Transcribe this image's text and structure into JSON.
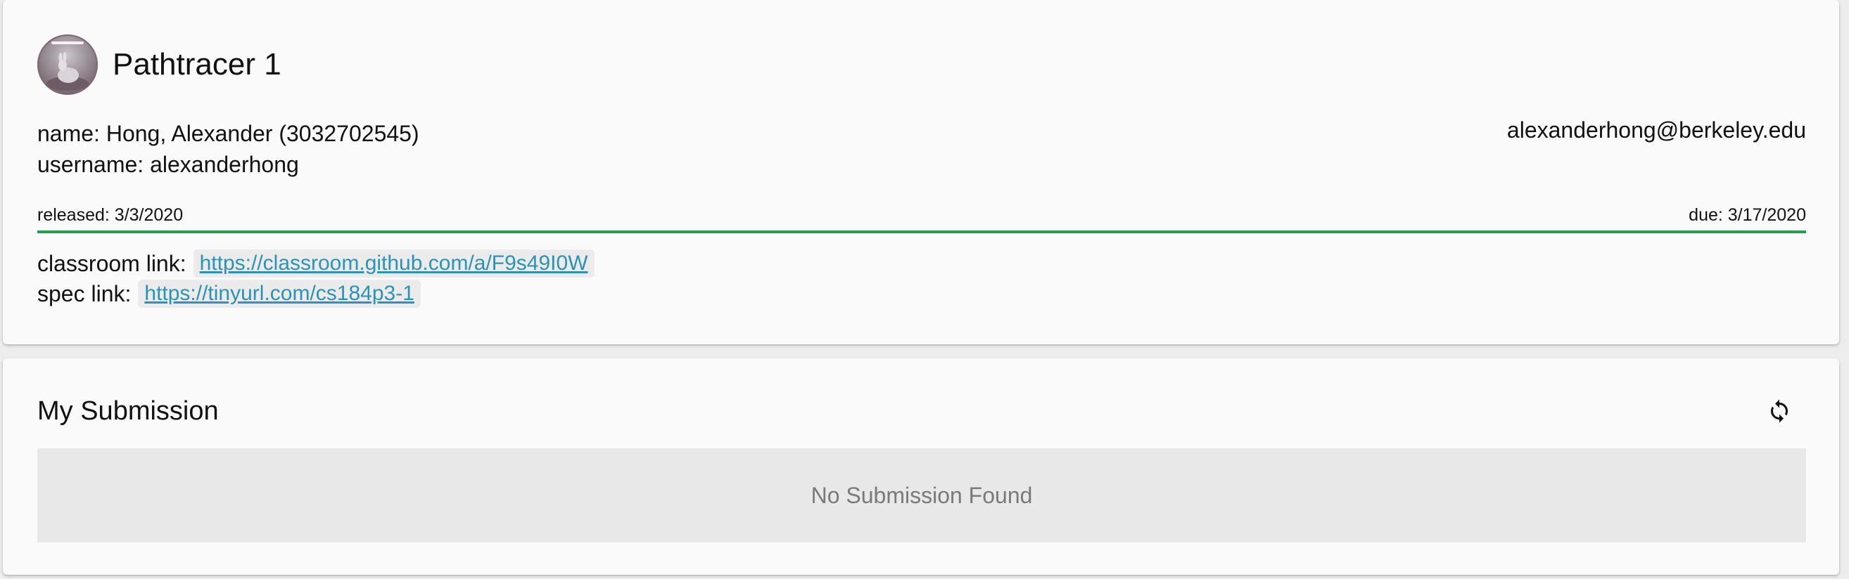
{
  "assignment": {
    "title": "Pathtracer 1",
    "name_text": "name: Hong, Alexander (3032702545)",
    "username_text": "username: alexanderhong",
    "email": "alexanderhong@berkeley.edu",
    "released_text": "released: 3/3/2020",
    "due_text": "due: 3/17/2020",
    "progress_percent": 100,
    "progress_color": "#21a052",
    "classroom_label": "classroom link:",
    "classroom_url": "https://classroom.github.com/a/F9s49I0W",
    "spec_label": "spec link:",
    "spec_url": "https://tinyurl.com/cs184p3-1"
  },
  "submission": {
    "title": "My Submission",
    "refresh_icon": "refresh-icon",
    "empty_text": "No Submission Found"
  },
  "colors": {
    "link": "#2b93b5",
    "chip_bg": "#ebebeb",
    "card_bg": "#fafafa"
  }
}
